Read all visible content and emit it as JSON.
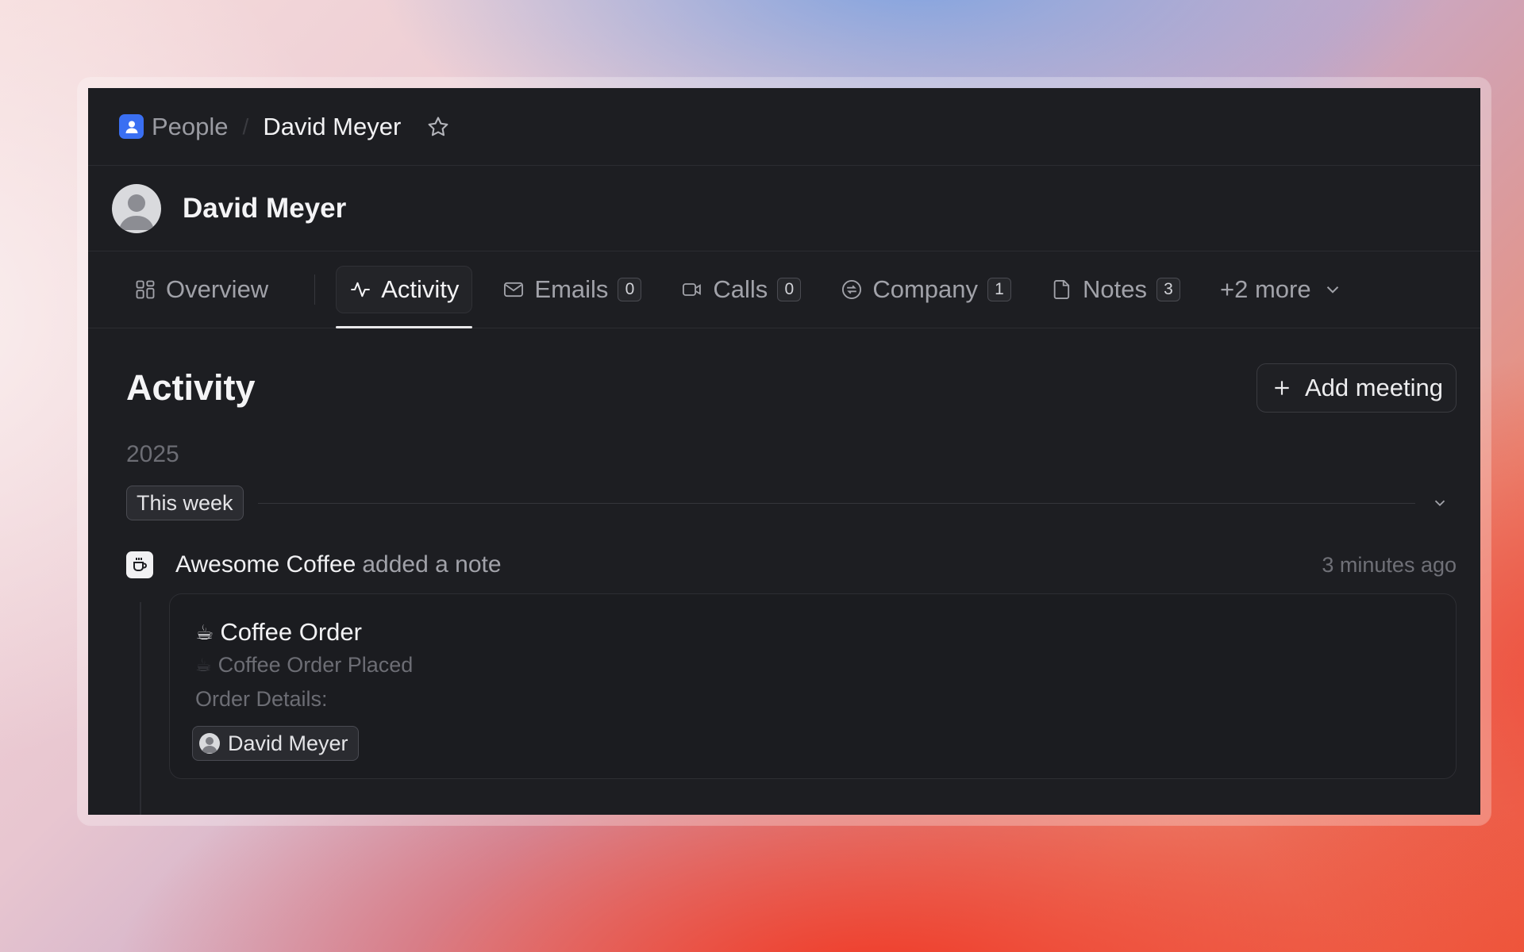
{
  "breadcrumb": {
    "section": "People",
    "current": "David Meyer"
  },
  "header": {
    "name": "David Meyer"
  },
  "tabs": [
    {
      "label": "Overview",
      "icon": "grid-icon"
    },
    {
      "label": "Activity",
      "icon": "pulse-icon",
      "active": true
    },
    {
      "label": "Emails",
      "icon": "mail-icon",
      "count": "0"
    },
    {
      "label": "Calls",
      "icon": "video-icon",
      "count": "0"
    },
    {
      "label": "Company",
      "icon": "company-icon",
      "count": "1"
    },
    {
      "label": "Notes",
      "icon": "file-icon",
      "count": "3"
    },
    {
      "label": "+2 more",
      "icon": "chevron-down-icon"
    }
  ],
  "activity": {
    "title": "Activity",
    "add_button": "Add meeting",
    "year": "2025",
    "period": "This week",
    "event": {
      "actor": "Awesome Coffee",
      "action": "added a note",
      "time": "3 minutes ago"
    },
    "note": {
      "emoji": "☕",
      "title": "Coffee Order",
      "subtitle": "Coffee Order Placed",
      "details_label": "Order Details:",
      "mention": "David Meyer"
    }
  },
  "colors": {
    "accent": "#3a6ff2",
    "window_bg": "#1d1e22",
    "text_muted": "#a1a2a9"
  }
}
